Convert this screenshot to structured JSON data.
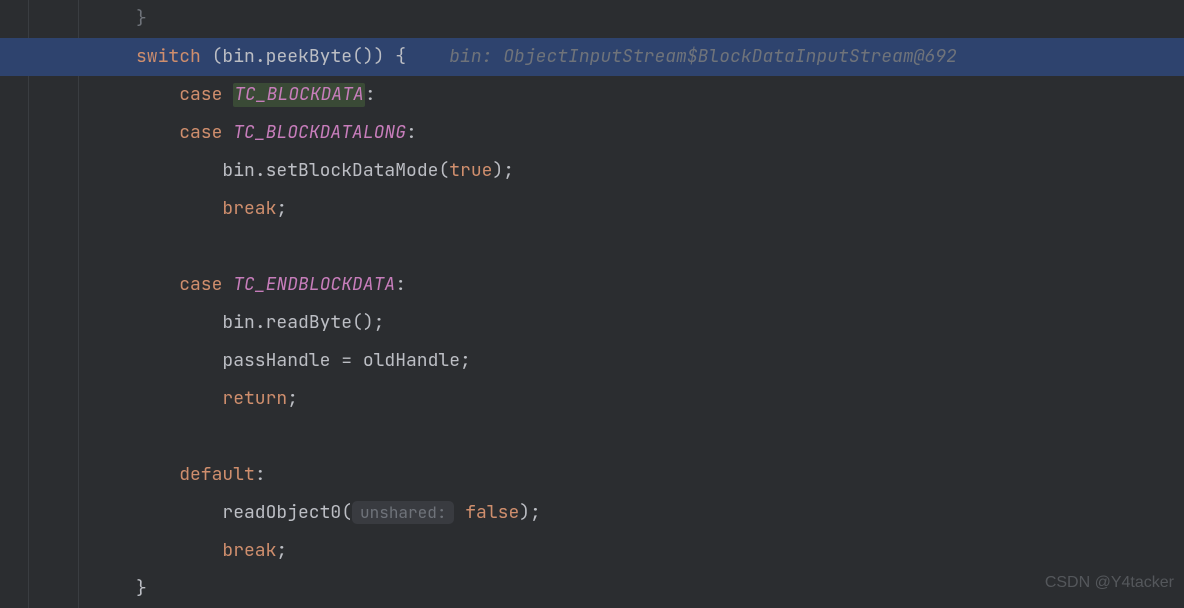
{
  "watermark": "CSDN @Y4tacker",
  "inlay": {
    "bin_hint": "bin: ObjectInputStream$BlockDataInputStream@692",
    "unshared_label": "unshared:"
  },
  "code": {
    "brace_close_top": "}",
    "switch_kw": "switch",
    "switch_open": " (",
    "bin_ident": "bin",
    "dot": ".",
    "peekByte": "peekByte",
    "call_close": "()) {",
    "case_kw": "case",
    "tc_blockdata": "TC_BLOCKDATA",
    "colon": ":",
    "tc_blockdatalong": "TC_BLOCKDATALONG",
    "setBlockDataMode": "setBlockDataMode",
    "true_kw": "true",
    "paren_close_semi": ");",
    "break_kw": "break",
    "semi": ";",
    "tc_endblockdata": "TC_ENDBLOCKDATA",
    "readByte": "readByte",
    "empty_call": "();",
    "passHandle": "passHandle",
    "eq": " = ",
    "oldHandle": "oldHandle",
    "return_kw": "return",
    "default_kw": "default",
    "readObject0": "readObject0",
    "paren_open": "(",
    "space": " ",
    "false_kw": "false",
    "brace_close": "}"
  }
}
